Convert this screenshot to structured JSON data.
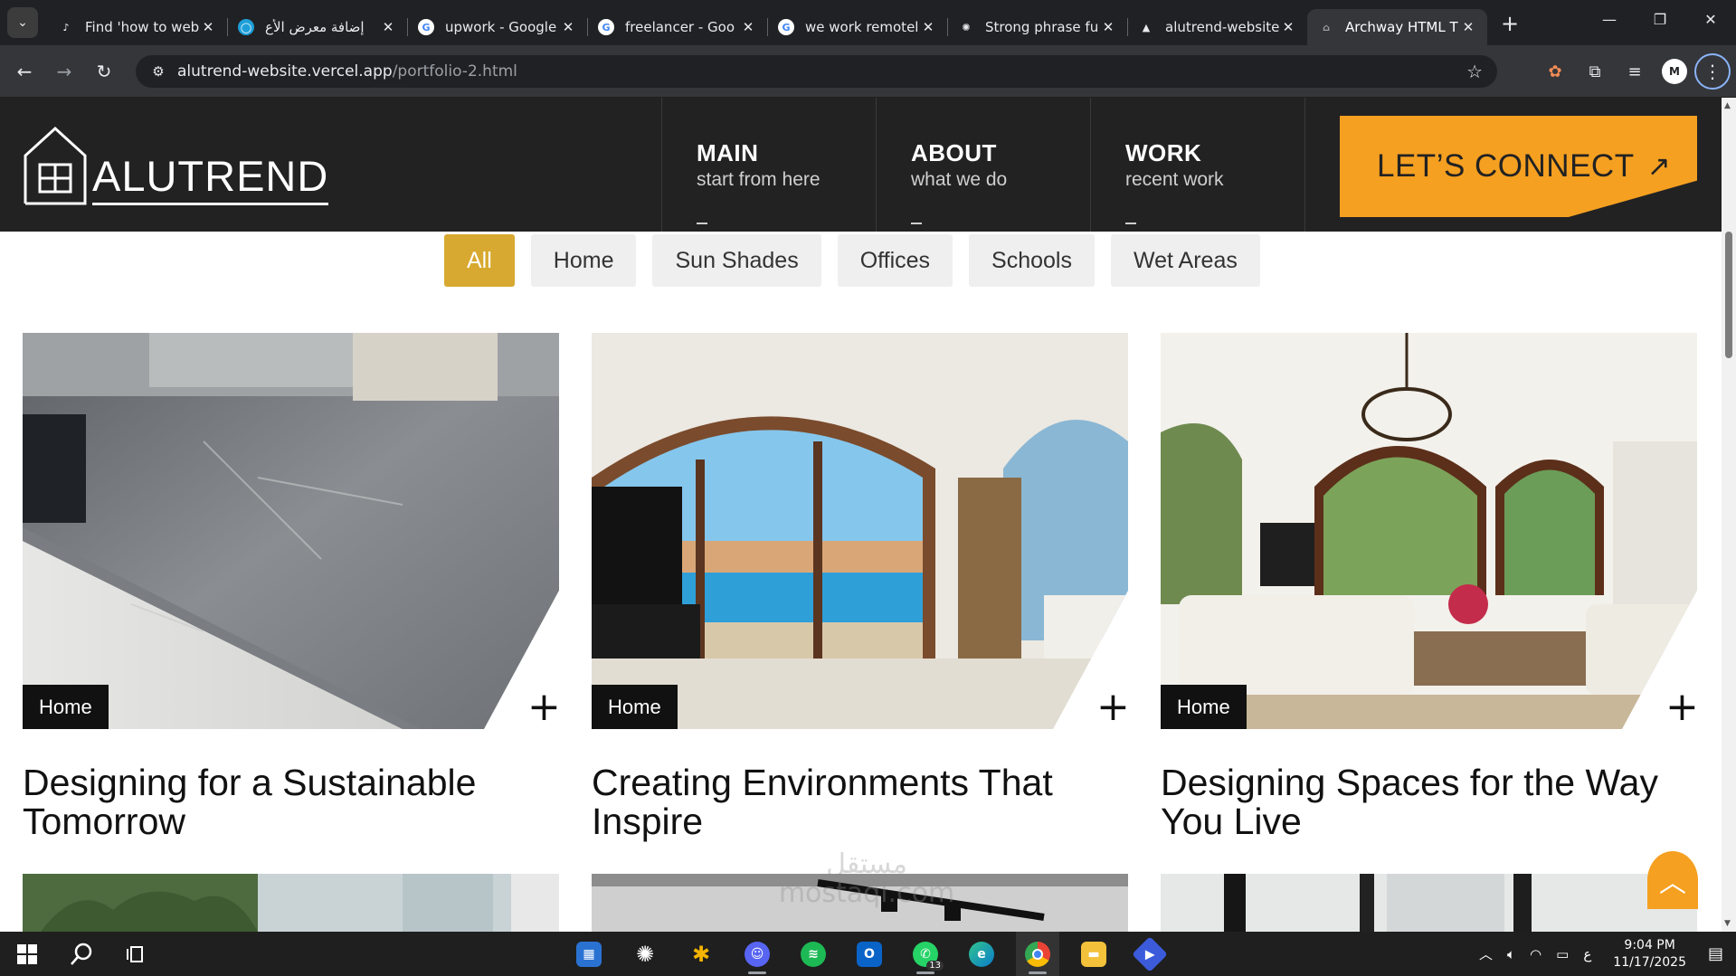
{
  "browser": {
    "tabs": [
      {
        "title": "Find 'how to web",
        "favicon": "tiktok-icon",
        "active": false
      },
      {
        "title": "إضافة معرض الأع",
        "favicon": "mostaql-icon",
        "active": false
      },
      {
        "title": "upwork - Google",
        "favicon": "google-icon",
        "active": false
      },
      {
        "title": "freelancer - Goo",
        "favicon": "google-icon",
        "active": false
      },
      {
        "title": "we work remotel",
        "favicon": "google-icon",
        "active": false
      },
      {
        "title": "Strong phrase fu",
        "favicon": "chatgpt-icon",
        "active": false
      },
      {
        "title": "alutrend-website",
        "favicon": "vercel-icon",
        "active": false
      },
      {
        "title": "Archway HTML T",
        "favicon": "archway-icon",
        "active": true
      }
    ],
    "url_host": "alutrend-website.vercel.app",
    "url_path": "/portfolio-2.html"
  },
  "site": {
    "logo_text": "ALUTREND",
    "nav": [
      {
        "main": "MAIN",
        "sub": "start from here"
      },
      {
        "main": "ABOUT",
        "sub": "what we do"
      },
      {
        "main": "WORK",
        "sub": "recent work"
      }
    ],
    "cta_label": "LET’S CONNECT",
    "cta_arrow": "↗",
    "accent_color": "#f5a021",
    "filter_active_color": "#d8a930",
    "filters": [
      "All",
      "Home",
      "Sun Shades",
      "Offices",
      "Schools",
      "Wet Areas"
    ],
    "active_filter": "All",
    "cards": [
      {
        "tag": "Home",
        "title": "Designing for a Sustainable Tomorrow"
      },
      {
        "tag": "Home",
        "title": "Creating Environments That Inspire"
      },
      {
        "tag": "Home",
        "title": "Designing Spaces for the Way You Live"
      }
    ],
    "plus_glyph": "+"
  },
  "taskbar": {
    "time": "9:04 PM",
    "date": "11/17/2025",
    "lang": "ع",
    "whatsapp_badge": "13"
  },
  "watermark": {
    "line1": "مستقل",
    "line2": "mostaql.com"
  }
}
